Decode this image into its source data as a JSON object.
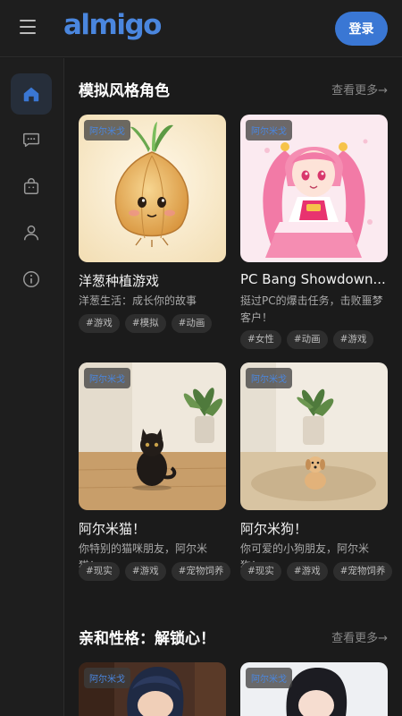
{
  "header": {
    "logo": "almigo",
    "login_label": "登录"
  },
  "sidebar": {
    "items": [
      {
        "name": "home",
        "icon": "home-icon",
        "active": true
      },
      {
        "name": "chat",
        "icon": "chat-icon",
        "active": false
      },
      {
        "name": "store",
        "icon": "bag-icon",
        "active": false
      },
      {
        "name": "profile",
        "icon": "user-icon",
        "active": false
      },
      {
        "name": "info",
        "icon": "info-icon",
        "active": false
      }
    ]
  },
  "sections": [
    {
      "title": "模拟风格角色",
      "see_more": "查看更多→",
      "cards": [
        {
          "badge": "阿尔米戈",
          "title": "洋葱种植游戏",
          "desc": "洋葱生活：成长你的故事",
          "tags": [
            "#游戏",
            "#模拟",
            "#动画"
          ]
        },
        {
          "badge": "阿尔米戈",
          "title": "PC Bang Showdown...",
          "desc": "挺过PC的爆击任务，击败噩梦客户！",
          "tags": [
            "#女性",
            "#动画",
            "#游戏"
          ]
        },
        {
          "badge": "阿尔米戈",
          "title": "阿尔米猫！",
          "desc": "你特别的猫咪朋友，阿尔米猫！",
          "tags": [
            "#现实",
            "#游戏",
            "#宠物饲养"
          ]
        },
        {
          "badge": "阿尔米戈",
          "title": "阿尔米狗！",
          "desc": "你可爱的小狗朋友，阿尔米狗！",
          "tags": [
            "#现实",
            "#游戏",
            "#宠物饲养"
          ]
        }
      ]
    },
    {
      "title": "亲和性格：解锁心！",
      "see_more": "查看更多→",
      "cards": [
        {
          "badge": "阿尔米戈"
        },
        {
          "badge": "阿尔米戈"
        }
      ]
    }
  ],
  "colors": {
    "accent": "#3a77d4",
    "logo": "#4a86de",
    "background": "#1b1b1b"
  }
}
